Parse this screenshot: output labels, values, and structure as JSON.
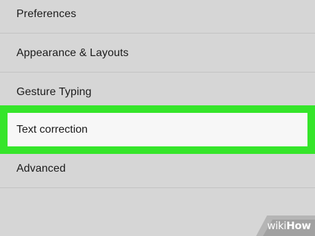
{
  "settings_list": {
    "items": [
      {
        "label": "Preferences"
      },
      {
        "label": "Appearance & Layouts"
      },
      {
        "label": "Gesture Typing"
      },
      {
        "label": "Text correction"
      },
      {
        "label": "Advanced"
      }
    ],
    "highlighted_item": "Text correction"
  },
  "colors": {
    "background": "#d6d6d6",
    "highlight_border": "#35e52a",
    "highlight_fill": "#f7f7f7"
  },
  "watermark": {
    "wiki": "wiki",
    "how": "How"
  }
}
